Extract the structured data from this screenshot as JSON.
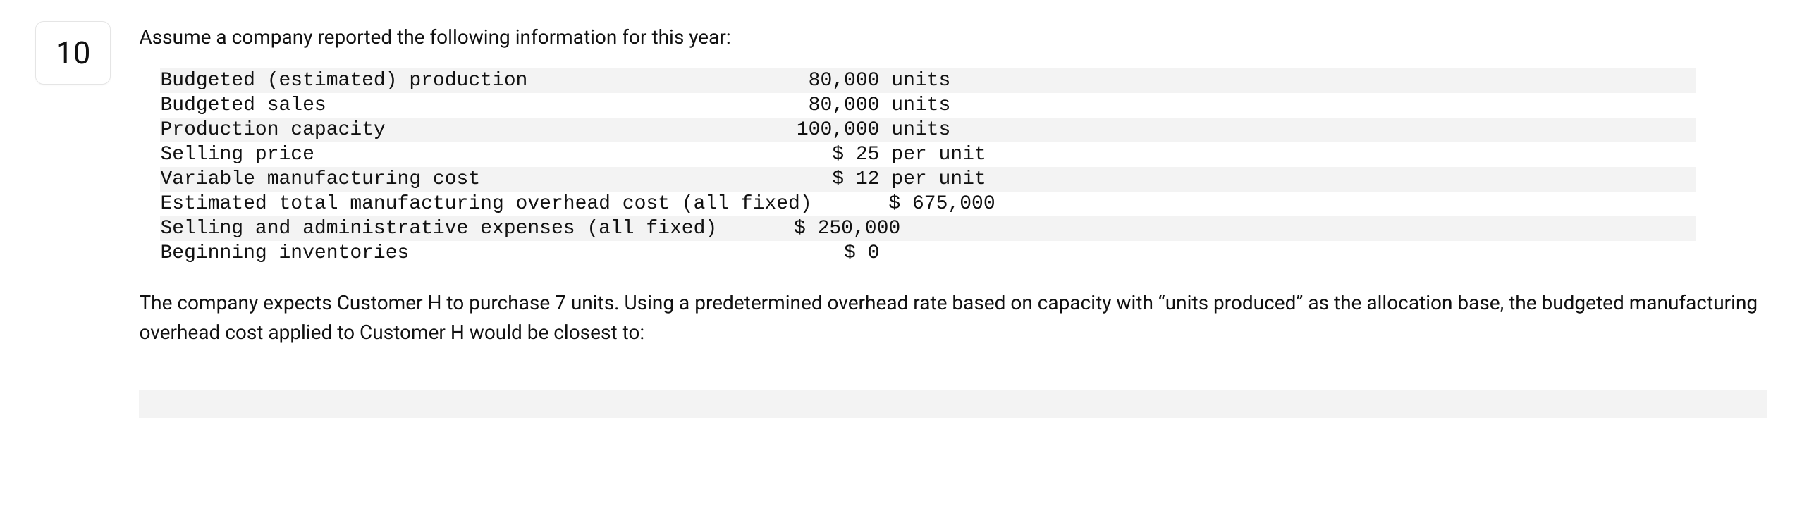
{
  "question": {
    "number": "10",
    "intro": "Assume a company reported the following information for this year:",
    "rows": [
      {
        "label": "Budgeted (estimated) production",
        "value": "80,000",
        "unit": " units"
      },
      {
        "label": "Budgeted sales",
        "value": "80,000",
        "unit": " units"
      },
      {
        "label": "Production capacity",
        "value": "100,000",
        "unit": " units"
      },
      {
        "label": "Selling price",
        "value": "$ 25",
        "unit": " per unit"
      },
      {
        "label": "Variable manufacturing cost",
        "value": "$ 12",
        "unit": " per unit"
      },
      {
        "label": "Estimated total manufacturing overhead cost (all fixed)",
        "value": "$ 675,000",
        "unit": ""
      },
      {
        "label": "Selling and administrative expenses (all fixed)",
        "value": "$ 250,000",
        "unit": ""
      },
      {
        "label": "Beginning inventories",
        "value": "$ 0",
        "unit": ""
      }
    ],
    "prompt": "The company expects Customer H to purchase 7 units. Using a predetermined overhead rate based on capacity with “units produced” as the allocation base, the budgeted manufacturing overhead cost applied to Customer H would be closest to:"
  }
}
